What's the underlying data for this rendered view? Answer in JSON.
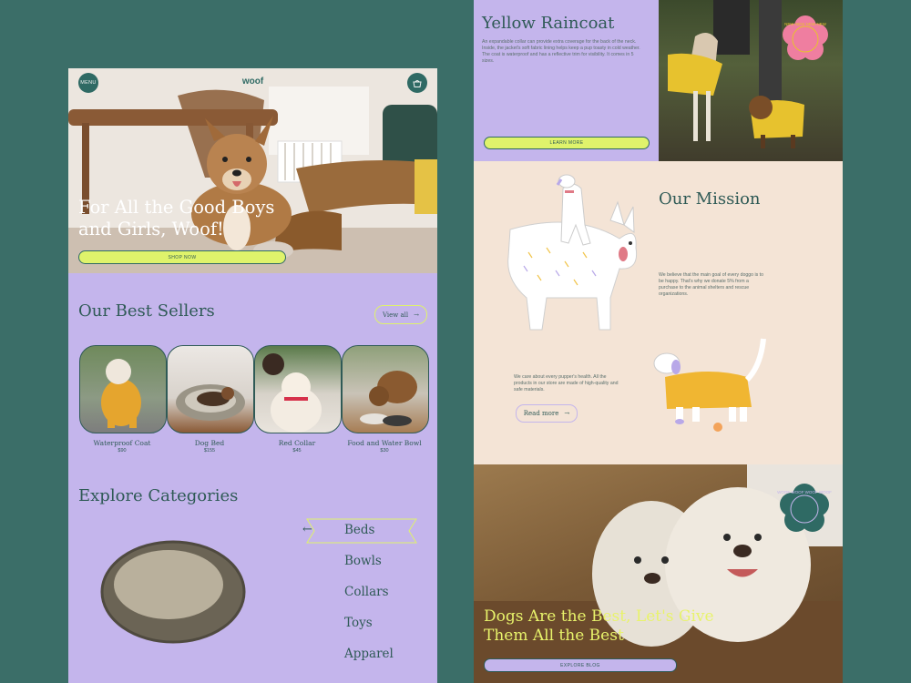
{
  "left": {
    "menu_label": "MENU",
    "logo": "woof",
    "hero_title": "For All the Good Boys and Girls, Woof!",
    "shop_now": "SHOP NOW",
    "best_sellers_title": "Our Best Sellers",
    "view_all": "View all",
    "products": [
      {
        "name": "Waterproof Coat",
        "price": "$90"
      },
      {
        "name": "Dog Bed",
        "price": "$155"
      },
      {
        "name": "Red Collar",
        "price": "$45"
      },
      {
        "name": "Food and Water Bowl",
        "price": "$30"
      }
    ],
    "categories_title": "Explore Categories",
    "categories": [
      "Beds",
      "Bowls",
      "Collars",
      "Toys",
      "Apparel"
    ]
  },
  "raincoat": {
    "title": "Yellow Raincoat",
    "description": "An expandable collar can provide extra coverage for the back of the neck. Inside, the jacket's soft fabric lining helps keep a pup toasty in cold weather. The coat is waterproof and has a reflective trim for visibility. It comes in 5 sizes.",
    "learn_more": "LEARN MORE",
    "badge_text": "NEW NEW NEW NEW"
  },
  "mission": {
    "title": "Our Mission",
    "para1": "We believe that the main goal of every doggo is to be happy. That's why we donate 5% from a purchase to the animal shelters and rescue organizations.",
    "para2": "We care about every pupper's health. All the products in our store are made of high-quality and safe materials.",
    "read_more": "Read more"
  },
  "dogs": {
    "title": "Dogs Are the Best, Let's Give Them All the Best",
    "explore_blog": "EXPLORE BLOG",
    "badge_text": "WOOF WOOF WOOF WOOF"
  },
  "colors": {
    "background": "#3b6e68",
    "lavender": "#c4b5ec",
    "lime": "#dff36b",
    "teal": "#2f5a56",
    "cream": "#f4e4d6",
    "pink_badge": "#ef7ea0"
  },
  "icons": [
    "menu-icon",
    "bag-icon",
    "arrow-right-icon",
    "arrow-left-icon"
  ]
}
